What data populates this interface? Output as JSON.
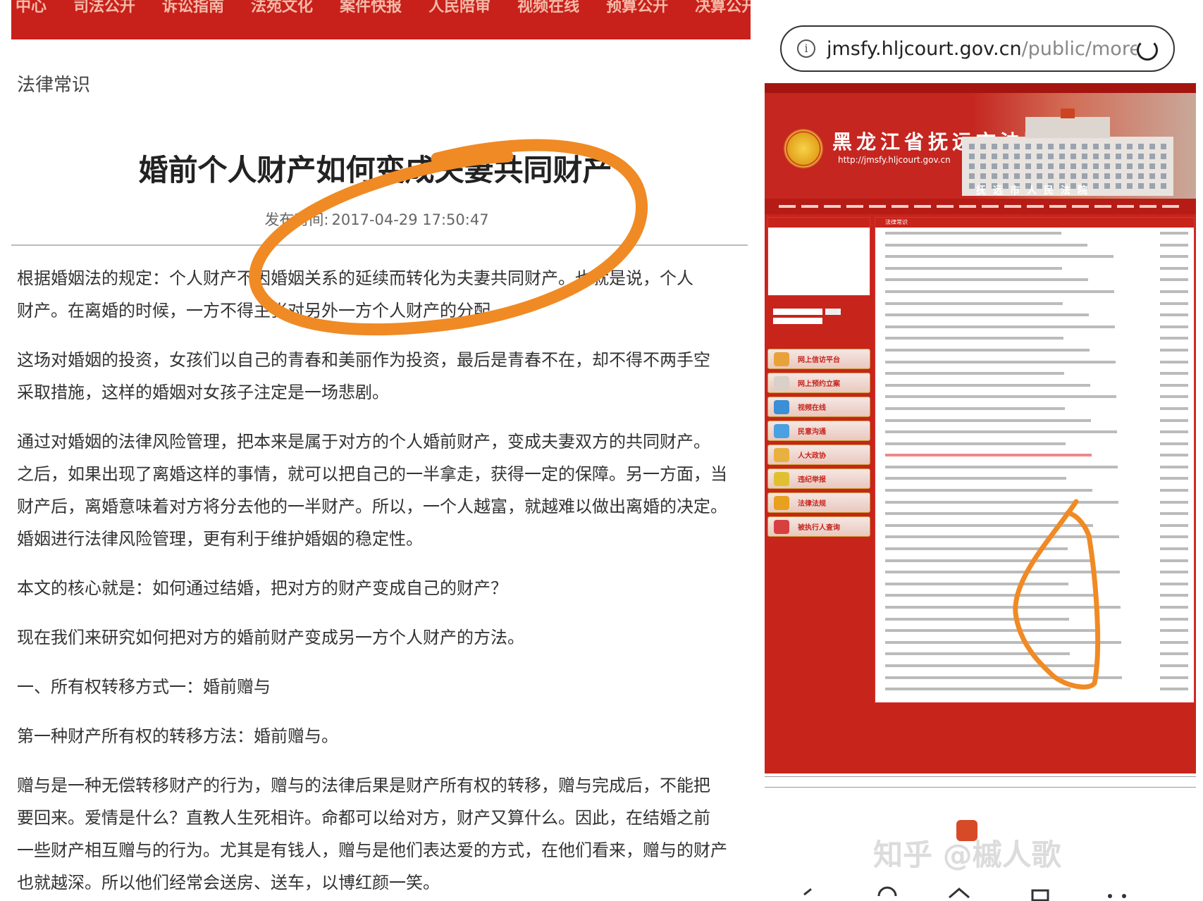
{
  "left": {
    "top_nav": [
      "中心",
      "司法公开",
      "诉讼指南",
      "法苑文化",
      "案件快报",
      "人民陪审",
      "视频在线",
      "预算公开",
      "决算公开"
    ],
    "category": "法律常识",
    "title": "婚前个人财产如何变成夫妻共同财产",
    "publish_label": "发布时间:",
    "publish_time": "2017-04-29 17:50:47",
    "paragraphs": [
      {
        "lines": [
          "根据婚姻法的规定：个人财产不因婚姻关系的延续而转化为夫妻共同财产。也就是说，个人",
          "财产。在离婚的时候，一方不得主张对另外一方个人财产的分配。"
        ]
      },
      {
        "lines": [
          "这场对婚姻的投资，女孩们以自己的青春和美丽作为投资，最后是青春不在，却不得不两手空",
          "采取措施，这样的婚姻对女孩子注定是一场悲剧。"
        ]
      },
      {
        "lines": [
          "通过对婚姻的法律风险管理，把本来是属于对方的个人婚前财产，变成夫妻双方的共同财产。",
          "之后，如果出现了离婚这样的事情，就可以把自己的一半拿走，获得一定的保障。另一方面，当",
          "财产后，离婚意味着对方将分去他的一半财产。所以，一个人越富，就越难以做出离婚的决定。",
          "婚姻进行法律风险管理，更有利于维护婚姻的稳定性。"
        ]
      },
      {
        "lines": [
          "本文的核心就是：如何通过结婚，把对方的财产变成自己的财产？"
        ]
      },
      {
        "lines": [
          "现在我们来研究如何把对方的婚前财产变成另一方个人财产的方法。"
        ]
      },
      {
        "lines": [
          "一、所有权转移方式一：婚前赠与"
        ]
      },
      {
        "lines": [
          "第一种财产所有权的转移方法：婚前赠与。"
        ]
      },
      {
        "lines": [
          "赠与是一种无偿转移财产的行为，赠与的法律后果是财产所有权的转移，赠与完成后，不能把",
          "要回来。爱情是什么？直教人生死相许。命都可以给对方，财产又算什么。因此，在结婚之前",
          "一些财产相互赠与的行为。尤其是有钱人，赠与是他们表达爱的方式，在他们看来，赠与的财产",
          "也就越深。所以他们经常会送房、送车，以博红颜一笑。"
        ]
      }
    ]
  },
  "right": {
    "url_host": "jmsfy.hljcourt.gov.cn",
    "url_path": "/public/more.p",
    "site_name": "黑龙江省抚远市法院网",
    "site_url": "http://jmsfy.hljcourt.gov.cn",
    "court_sign": "抚远市人民法院",
    "list_head": "法律常识",
    "sidebar_buttons": [
      "网上信访平台",
      "网上预约立案",
      "视频在线",
      "民意沟通",
      "人大政协",
      "违纪举报",
      "法律法规",
      "被执行人查询"
    ],
    "watermark": "知乎 @槭人歌",
    "colors": {
      "site_red": "#c7241c",
      "annotation_orange": "#f08a24"
    }
  }
}
